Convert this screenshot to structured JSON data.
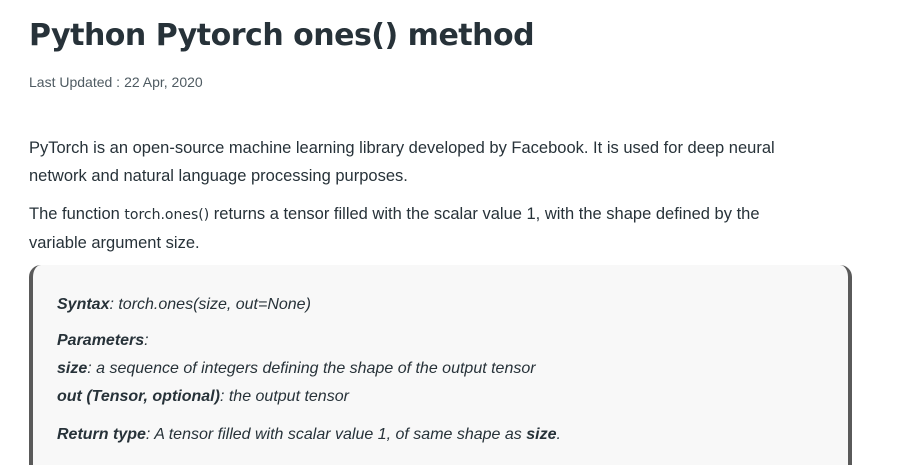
{
  "article": {
    "title": "Python Pytorch ones() method",
    "last_updated_label": "Last Updated :",
    "last_updated_date": "22 Apr, 2020",
    "paragraphs": {
      "p1": "PyTorch is an open-source machine learning library developed by Facebook. It is used for deep neural network and natural language processing purposes.",
      "p2_before": "The function ",
      "p2_code": "torch.ones()",
      "p2_after": " returns a tensor filled with the scalar value 1, with the shape defined by the variable argument size."
    }
  },
  "syntax_box": {
    "syntax_label": "Syntax",
    "syntax_text": ": torch.ones(size, out=None)",
    "parameters_label": "Parameters",
    "parameters_colon": ":",
    "size_label": "size",
    "size_text": ": a sequence of integers defining the shape of the output tensor",
    "out_label": "out (Tensor, optional)",
    "out_text": ": the output tensor",
    "return_label": "Return type",
    "return_text": ": A tensor filled with scalar value 1, of same shape as ",
    "return_bold": "size",
    "return_end": "."
  }
}
